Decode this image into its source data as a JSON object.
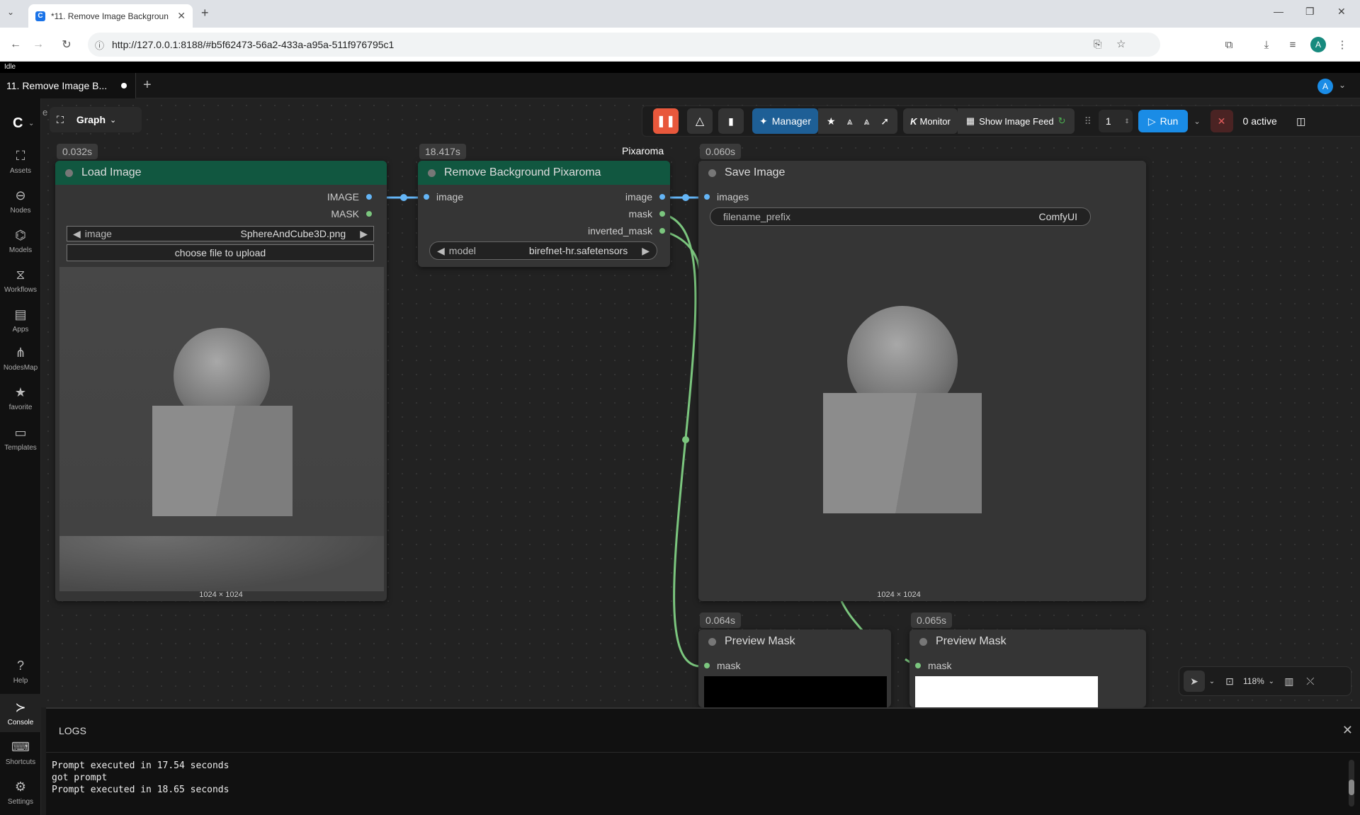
{
  "browser": {
    "tab_title": "*11. Remove Image Backgroun",
    "url": "http://127.0.0.1:8188/#b5f62473-56a2-433a-a95a-511f976795c1",
    "profile_initial": "A"
  },
  "app": {
    "status": "Idle",
    "workflow_tab": "11. Remove Image B...",
    "profile_initial": "A",
    "graph_label": "Graph",
    "partial_label": "e"
  },
  "sidebar": {
    "items": [
      {
        "label": "Assets",
        "icon": "image-icon"
      },
      {
        "label": "Nodes",
        "icon": "node-icon"
      },
      {
        "label": "Models",
        "icon": "models-icon"
      },
      {
        "label": "Workflows",
        "icon": "workflow-icon"
      },
      {
        "label": "Apps",
        "icon": "apps-icon"
      },
      {
        "label": "NodesMap",
        "icon": "nodesmap-icon"
      },
      {
        "label": "favorite",
        "icon": "star-icon"
      },
      {
        "label": "Templates",
        "icon": "templates-icon"
      }
    ],
    "bottom": [
      {
        "label": "Help",
        "icon": "help-icon"
      },
      {
        "label": "Console",
        "icon": "console-icon"
      },
      {
        "label": "Shortcuts",
        "icon": "keyboard-icon"
      },
      {
        "label": "Settings",
        "icon": "gear-icon"
      }
    ]
  },
  "topbar": {
    "manager": "Manager",
    "monitor": "Monitor",
    "image_feed": "Show Image Feed",
    "batch_count": "1",
    "run": "Run",
    "active": "0 active",
    "accent": "#e8583c",
    "run_color": "#1a8ce6"
  },
  "nodes": {
    "load_image": {
      "time": "0.032s",
      "title": "Load Image",
      "outputs": [
        "IMAGE",
        "MASK"
      ],
      "widget_label": "image",
      "widget_value": "SphereAndCube3D.png",
      "upload": "choose file to upload",
      "dims": "1024 × 1024"
    },
    "remove_bg": {
      "time": "18.417s",
      "group": "Pixaroma",
      "title": "Remove Background Pixaroma",
      "input": "image",
      "outputs": [
        "image",
        "mask",
        "inverted_mask"
      ],
      "widget_label": "model",
      "widget_value": "birefnet-hr.safetensors"
    },
    "save_image": {
      "time": "0.060s",
      "title": "Save Image",
      "input": "images",
      "widget_label": "filename_prefix",
      "widget_value": "ComfyUI",
      "dims": "1024 × 1024"
    },
    "preview_mask_1": {
      "time": "0.064s",
      "title": "Preview Mask",
      "input": "mask"
    },
    "preview_mask_2": {
      "time": "0.065s",
      "title": "Preview Mask",
      "input": "mask"
    }
  },
  "canvas_tools": {
    "zoom": "118%"
  },
  "logs": {
    "title": "LOGS",
    "lines": [
      "Prompt executed in 17.54 seconds",
      "got prompt",
      "Prompt executed in 18.65 seconds"
    ]
  }
}
